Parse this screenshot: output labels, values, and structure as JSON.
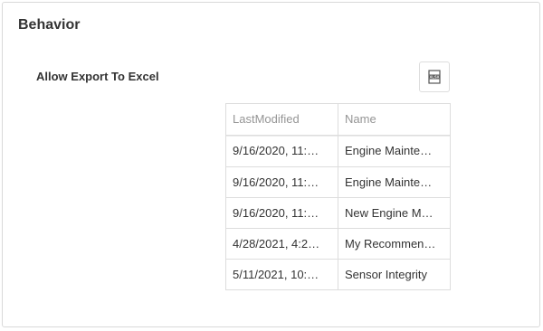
{
  "section": {
    "title": "Behavior"
  },
  "setting": {
    "label": "Allow Export To Excel"
  },
  "export_button": {
    "icon": "excel-export-icon",
    "icon_text": "XLSX"
  },
  "grid": {
    "columns": [
      "LastModified",
      "Name"
    ],
    "rows": [
      [
        "9/16/2020, 11:…",
        "Engine Mainte…"
      ],
      [
        "9/16/2020, 11:…",
        "Engine Mainte…"
      ],
      [
        "9/16/2020, 11:…",
        "New Engine M…"
      ],
      [
        "4/28/2021, 4:2…",
        "My Recommen…"
      ],
      [
        "5/11/2021, 10:…",
        "Sensor Integrity"
      ]
    ]
  }
}
